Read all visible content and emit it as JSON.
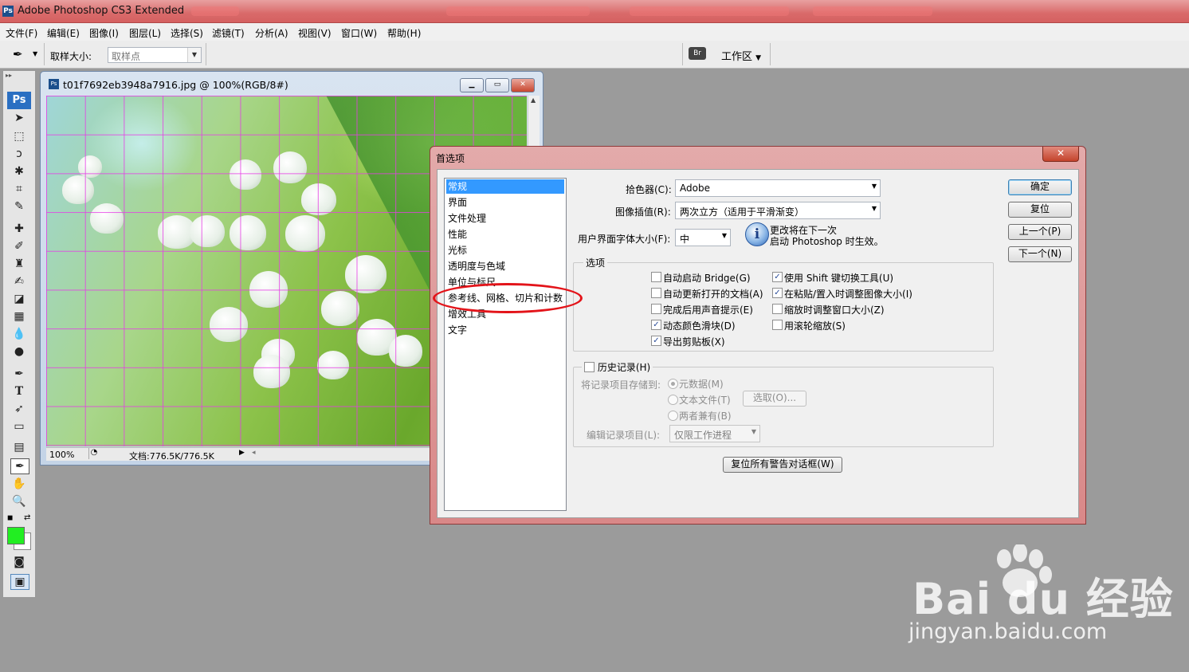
{
  "window": {
    "title": "Adobe Photoshop CS3 Extended",
    "logo": "Ps"
  },
  "menubar": [
    "文件(F)",
    "编辑(E)",
    "图像(I)",
    "图层(L)",
    "选择(S)",
    "滤镜(T)",
    "分析(A)",
    "视图(V)",
    "窗口(W)",
    "帮助(H)"
  ],
  "options": {
    "sample_size_label": "取样大小:",
    "sample_size_value": "取样点",
    "workspace_label": "工作区"
  },
  "toolbox": {
    "logo": "Ps"
  },
  "document": {
    "title": "t01f7692eb3948a7916.jpg @ 100%(RGB/8#)",
    "zoom": "100%",
    "doc_info": "文档:776.5K/776.5K"
  },
  "dialog": {
    "title": "首选项",
    "categories": [
      "常规",
      "界面",
      "文件处理",
      "性能",
      "光标",
      "透明度与色域",
      "单位与标尺",
      "参考线、网格、切片和计数",
      "增效工具",
      "文字"
    ],
    "selected_category": 0,
    "color_picker_label": "拾色器(C):",
    "color_picker_value": "Adobe",
    "interpolation_label": "图像插值(R):",
    "interpolation_value": "两次立方（适用于平滑渐变）",
    "ui_font_label": "用户界面字体大小(F):",
    "ui_font_value": "中",
    "ui_font_note_1": "更改将在下一次",
    "ui_font_note_2": "启动 Photoshop 时生效。",
    "options_group": "选项",
    "options": [
      {
        "label": "自动启动 Bridge(G)",
        "checked": false
      },
      {
        "label": "使用 Shift 键切换工具(U)",
        "checked": true
      },
      {
        "label": "自动更新打开的文档(A)",
        "checked": false
      },
      {
        "label": "在粘贴/置入时调整图像大小(I)",
        "checked": true
      },
      {
        "label": "完成后用声音提示(E)",
        "checked": false
      },
      {
        "label": "缩放时调整窗口大小(Z)",
        "checked": false
      },
      {
        "label": "动态颜色滑块(D)",
        "checked": true
      },
      {
        "label": "用滚轮缩放(S)",
        "checked": false
      },
      {
        "label": "导出剪贴板(X)",
        "checked": true
      }
    ],
    "history_label": "历史记录(H)",
    "history_save_label": "将记录项目存储到:",
    "history_radios": [
      "元数据(M)",
      "文本文件(T)",
      "两者兼有(B)"
    ],
    "choose_button": "选取(O)...",
    "edit_log_label": "编辑记录项目(L):",
    "edit_log_value": "仅限工作进程",
    "reset_warnings_button": "复位所有警告对话框(W)",
    "buttons": {
      "ok": "确定",
      "reset": "复位",
      "prev": "上一个(P)",
      "next": "下一个(N)"
    }
  },
  "watermark": {
    "brand": "Bai du 经验",
    "url": "jingyan.baidu.com"
  },
  "colors": {
    "foreground": "#22ee22",
    "background": "#ffffff",
    "highlight": "#e3141a",
    "selection": "#3399ff"
  }
}
